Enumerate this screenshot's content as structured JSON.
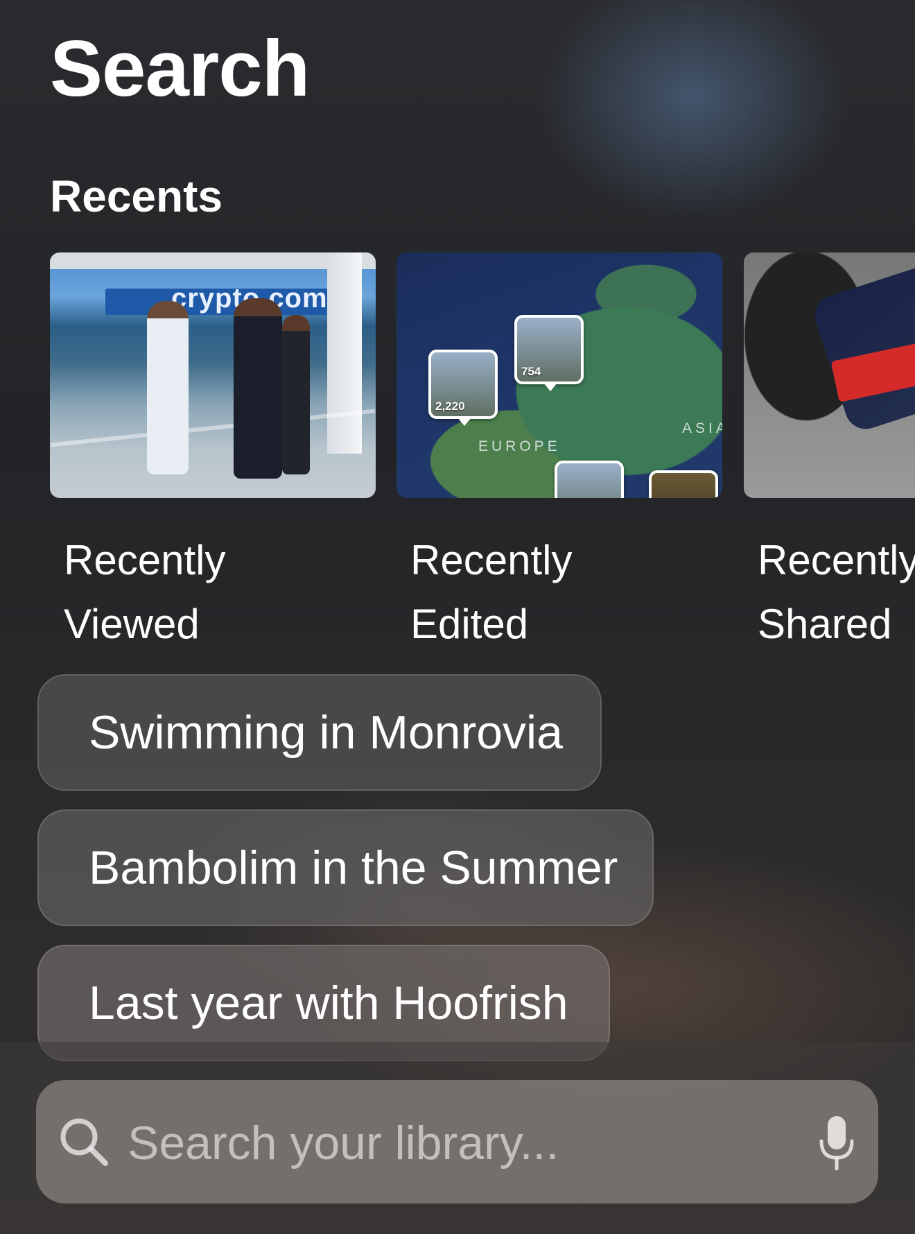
{
  "header": {
    "title": "Search"
  },
  "recents": {
    "title": "Recents",
    "cards": [
      {
        "line1": "Recently",
        "line2": "Viewed"
      },
      {
        "line1": "Recently",
        "line2": "Edited"
      },
      {
        "line1": "Recently",
        "line2": "Shared"
      }
    ],
    "viewed_thumb": {
      "banner_text": "crypto.com"
    },
    "map": {
      "region_label": "EUROPE",
      "region_label_2": "ASIA",
      "pin_counts": [
        "2,220",
        "754"
      ]
    }
  },
  "suggestions": [
    "Swimming in Monrovia",
    "Bambolim in the Summer",
    "Last year with Hoofrish"
  ],
  "search": {
    "placeholder": "Search your library...",
    "value": ""
  },
  "icons": {
    "search": "search-icon",
    "mic": "microphone-icon"
  }
}
